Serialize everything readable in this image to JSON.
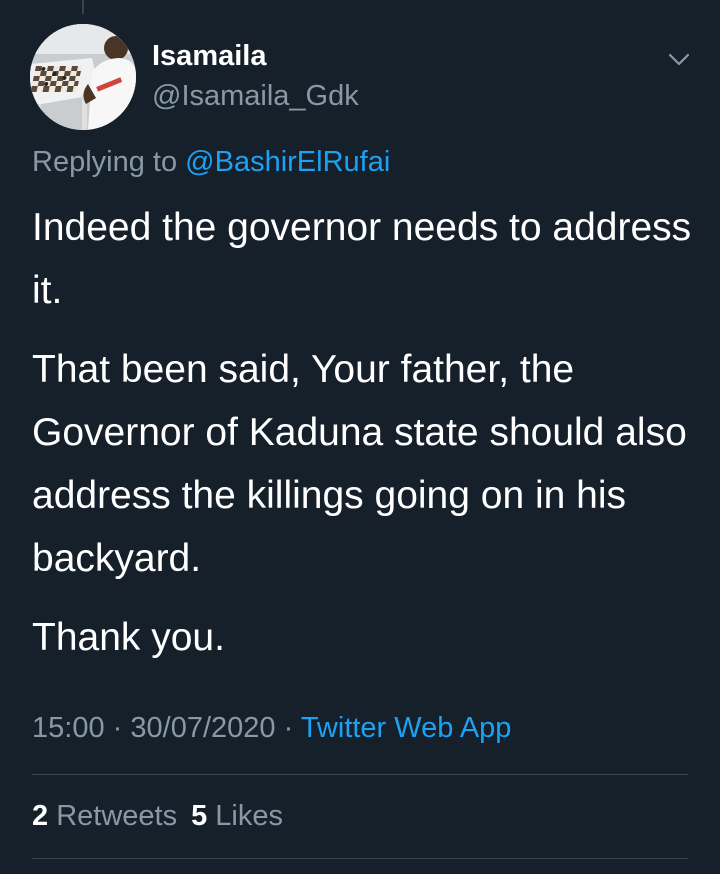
{
  "tweet": {
    "display_name": "Isamaila",
    "handle": "@Isamaila_Gdk",
    "replying_prefix": "Replying to",
    "replying_to": "@BashirElRufai",
    "paragraphs": [
      "Indeed the governor needs to address it.",
      "That been said, Your father, the Governor of Kaduna state should also address the killings going on in his backyard.",
      "Thank you."
    ],
    "time": "15:00",
    "date": "30/07/2020",
    "separator": "·",
    "source": "Twitter Web App",
    "retweets_count": "2",
    "retweets_label": "Retweets",
    "likes_count": "5",
    "likes_label": "Likes"
  },
  "icons": {
    "menu": "chevron-down-icon",
    "avatar": "profile-photo-chessboard"
  },
  "colors": {
    "background": "#15202b",
    "text_primary": "#ffffff",
    "text_secondary": "#8899a6",
    "link": "#1da1f2",
    "divider": "#38444d"
  }
}
